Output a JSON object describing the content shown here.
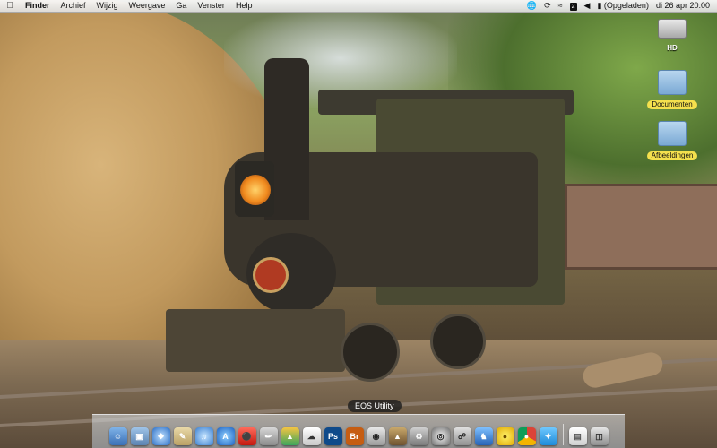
{
  "menubar": {
    "app_name": "Finder",
    "menus": [
      "Archief",
      "Wijzig",
      "Weergave",
      "Ga",
      "Venster",
      "Help"
    ],
    "battery_status": "(Opgeladen)",
    "tray_box": "2",
    "clock": "di 26 apr  20:00"
  },
  "desktop_icons": {
    "hd": "HD",
    "documents": "Documenten",
    "pictures": "Afbeeldingen"
  },
  "dock": {
    "tooltip": "EOS Utility",
    "ps_label": "Ps",
    "br_label": "Br",
    "icons": [
      "finder-icon",
      "preview-icon",
      "safari-icon",
      "script-icon",
      "itunes-icon",
      "app-store-icon",
      "flashlight-icon",
      "pencil-icon",
      "stocks-icon",
      "cloud-icon",
      "photoshop-icon",
      "bridge-icon",
      "eos-utility-icon",
      "photos-icon",
      "gears-icon",
      "lens-icon",
      "disk-utility-icon",
      "network-icon",
      "duck-icon",
      "chrome-icon",
      "twitter-icon",
      "documents-stack-icon",
      "trash-icon"
    ]
  },
  "colors": {
    "ps": "#0f4a8a",
    "br": "#c65d12",
    "folder_label": "#f4e04d"
  }
}
